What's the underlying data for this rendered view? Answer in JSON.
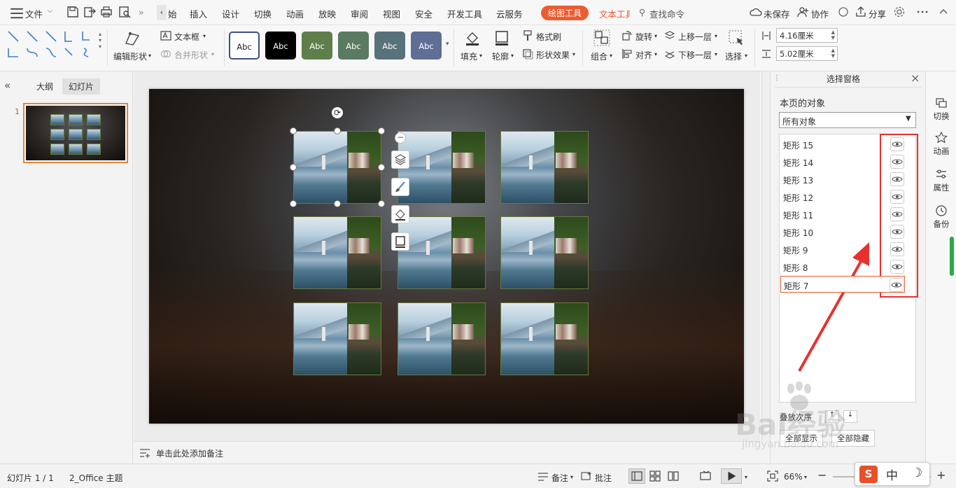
{
  "menubar": {
    "file_label": "文件",
    "tabs": [
      "始",
      "插入",
      "设计",
      "切换",
      "动画",
      "放映",
      "审阅",
      "视图",
      "安全",
      "开发工具",
      "云服务"
    ],
    "drawing_tools": "绘图工具",
    "text_tools": "文本工具",
    "search": "查找命令",
    "unsaved": "未保存",
    "collaborate": "协作",
    "share": "分享"
  },
  "ribbon": {
    "edit_shape": "编辑形状",
    "text_box": "文本框",
    "merge_shape": "合并形状",
    "styles": [
      {
        "label": "Abc",
        "bg": "#ffffff",
        "fg": "#222222",
        "border": "#3d4f8a"
      },
      {
        "label": "Abc",
        "bg": "#000000",
        "fg": "#ffffff",
        "border": "#000000"
      },
      {
        "label": "Abc",
        "bg": "#5e7e4a",
        "fg": "#ffffff",
        "border": "#5e7e4a"
      },
      {
        "label": "Abc",
        "bg": "#5a7a62",
        "fg": "#ffffff",
        "border": "#5a7a62"
      },
      {
        "label": "Abc",
        "bg": "#58727a",
        "fg": "#ffffff",
        "border": "#58727a"
      },
      {
        "label": "Abc",
        "bg": "#5e6e94",
        "fg": "#ffffff",
        "border": "#5e6e94"
      }
    ],
    "fill": "填充",
    "outline": "轮廓",
    "format_brush": "格式刷",
    "shape_effect": "形状效果",
    "group": "组合",
    "rotate": "旋转",
    "align": "对齐",
    "bring_forward": "上移一层",
    "send_backward": "下移一层",
    "select": "选择",
    "height": "4.16厘米",
    "width": "5.02厘米"
  },
  "leftpanel": {
    "tab_outline": "大纲",
    "tab_slides": "幻灯片",
    "slide_number": "1"
  },
  "notes_placeholder": "单击此处添加备注",
  "selection_pane": {
    "title": "选择窗格",
    "section_label": "本页的对象",
    "filter_value": "所有对象",
    "objects": [
      "矩形 15",
      "矩形 14",
      "矩形 13",
      "矩形 12",
      "矩形 11",
      "矩形 10",
      "矩形 9",
      "矩形 8",
      "矩形 7"
    ],
    "selected_object": "矩形 7",
    "order_label": "叠放次序",
    "show_all": "全部显示",
    "hide_all": "全部隐藏"
  },
  "sideicons": [
    "切换",
    "动画",
    "属性",
    "备份"
  ],
  "statusbar": {
    "slide_info": "幻灯片 1 / 1",
    "theme": "2_Office 主题",
    "notes": "备注",
    "comments": "批注",
    "zoom": "66%"
  },
  "annotation_color": "#e8312f",
  "accent": "#ed5b2f",
  "watermark": {
    "brand": "Bai经验",
    "url": "jingyan.baidu.com"
  },
  "ime": {
    "language": "中"
  }
}
